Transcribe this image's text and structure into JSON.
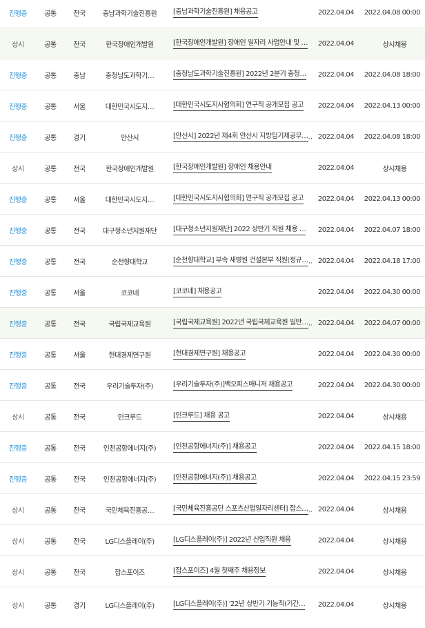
{
  "rows": [
    {
      "status": "진행중",
      "active": true,
      "type": "공통",
      "region": "전국",
      "org": "충남과학기술진흥원",
      "title": "[충남과학기술진흥원] 채용공고",
      "date": "2022.04.04",
      "deadline": "2022.04.08 00:00",
      "alt": false
    },
    {
      "status": "상시",
      "active": false,
      "type": "공통",
      "region": "전국",
      "org": "한국장애인개발원",
      "title": "[한국장애인개발원] 장애인 일자리 사업안내 및 …",
      "date": "2022.04.04",
      "deadline": "상시채용",
      "alt": true
    },
    {
      "status": "진행중",
      "active": true,
      "type": "공통",
      "region": "충남",
      "org": "충청남도과학기…",
      "title": "[충청남도과학기술진흥원] 2022년 2분기 충청…",
      "date": "2022.04.04",
      "deadline": "2022.04.08 18:00",
      "alt": false
    },
    {
      "status": "진행중",
      "active": true,
      "type": "공통",
      "region": "서울",
      "org": "대한민국시도지…",
      "title": "[대한민국시도지사협의회] 연구직 공개모집 공고",
      "date": "2022.04.04",
      "deadline": "2022.04.13 00:00",
      "alt": false
    },
    {
      "status": "진행중",
      "active": true,
      "type": "공통",
      "region": "경기",
      "org": "안산시",
      "title": "[안산시] 2022년 제4회 안산시 지방임기제공무…",
      "date": "2022.04.04",
      "deadline": "2022.04.08 18:00",
      "alt": false
    },
    {
      "status": "상시",
      "active": false,
      "type": "공통",
      "region": "전국",
      "org": "한국장애인개발원",
      "title": "[한국장애인개발원] 장애인 채용안내",
      "date": "2022.04.04",
      "deadline": "상시채용",
      "alt": false
    },
    {
      "status": "진행중",
      "active": true,
      "type": "공통",
      "region": "서울",
      "org": "대한민국시도지…",
      "title": "[대한민국시도지사협의회] 연구직 공개모집 공고",
      "date": "2022.04.04",
      "deadline": "2022.04.13 00:00",
      "alt": false
    },
    {
      "status": "진행중",
      "active": true,
      "type": "공통",
      "region": "전국",
      "org": "대구청소년지원재단",
      "title": "[대구청소년지원재단] 2022 상반기 직원 채용 …",
      "date": "2022.04.04",
      "deadline": "2022.04.07 18:00",
      "alt": false
    },
    {
      "status": "진행중",
      "active": true,
      "type": "공통",
      "region": "전국",
      "org": "순천향대학교",
      "title": "[순천향대학교] 부속 새병원 건설본부 직원(정규…",
      "date": "2022.04.04",
      "deadline": "2022.04.18 17:00",
      "alt": false
    },
    {
      "status": "진행중",
      "active": true,
      "type": "공통",
      "region": "서울",
      "org": "코코네",
      "title": "[코코네] 채용공고",
      "date": "2022.04.04",
      "deadline": "2022.04.30 00:00",
      "alt": false
    },
    {
      "status": "진행중",
      "active": true,
      "type": "공통",
      "region": "전국",
      "org": "국립국제교육원",
      "title": "[국립국제교육원] 2022년 국립국제교육원 일반…",
      "date": "2022.04.04",
      "deadline": "2022.04.07 00:00",
      "alt": true
    },
    {
      "status": "진행중",
      "active": true,
      "type": "공통",
      "region": "서울",
      "org": "현대경제연구원",
      "title": "[현대경제연구원] 채용공고",
      "date": "2022.04.04",
      "deadline": "2022.04.30 00:00",
      "alt": false
    },
    {
      "status": "진행중",
      "active": true,
      "type": "공통",
      "region": "전국",
      "org": "우리기술투자(주)",
      "title": "[우리기술투자(주)]백오피스매니저 채용공고",
      "date": "2022.04.04",
      "deadline": "2022.04.30 00:00",
      "alt": false
    },
    {
      "status": "상시",
      "active": false,
      "type": "공통",
      "region": "전국",
      "org": "인크루드",
      "title": "[인크루드] 채용 공고",
      "date": "2022.04.04",
      "deadline": "상시채용",
      "alt": false
    },
    {
      "status": "진행중",
      "active": true,
      "type": "공통",
      "region": "전국",
      "org": "인천공항에너지(주)",
      "title": "[인천공항에너지(주)] 채용공고",
      "date": "2022.04.04",
      "deadline": "2022.04.15 18:00",
      "alt": false
    },
    {
      "status": "진행중",
      "active": true,
      "type": "공통",
      "region": "전국",
      "org": "인천공항에너지(주)",
      "title": "[인천공항에너지(주)] 채용공고",
      "date": "2022.04.04",
      "deadline": "2022.04.15 23:59",
      "alt": false
    },
    {
      "status": "상시",
      "active": false,
      "type": "공통",
      "region": "전국",
      "org": "국민체육진흥공…",
      "title": "[국민체육진흥공단 스포츠산업일자리센터] 잡스…",
      "date": "2022.04.04",
      "deadline": "상시채용",
      "alt": false
    },
    {
      "status": "상시",
      "active": false,
      "type": "공통",
      "region": "전국",
      "org": "LG디스플레이(주)",
      "title": "[LG디스플레이(주)] 2022년 신입직원 채용",
      "date": "2022.04.04",
      "deadline": "상시채용",
      "alt": false
    },
    {
      "status": "상시",
      "active": false,
      "type": "공통",
      "region": "전국",
      "org": "잡스포이즈",
      "title": "[잡스포이즈] 4월 첫째주 채용정보",
      "date": "2022.04.04",
      "deadline": "상시채용",
      "alt": false
    },
    {
      "status": "상시",
      "active": false,
      "type": "공통",
      "region": "경기",
      "org": "LG디스플레이(주)",
      "title": "[LG디스플레이(주)] '22년 상반기 기능직(기간…",
      "date": "2022.04.04",
      "deadline": "상시채용",
      "alt": false
    }
  ],
  "colors": {
    "active_status": "#2e8fd0",
    "alt_row_bg": "#f6f9f2",
    "border": "#e5e5e5"
  }
}
